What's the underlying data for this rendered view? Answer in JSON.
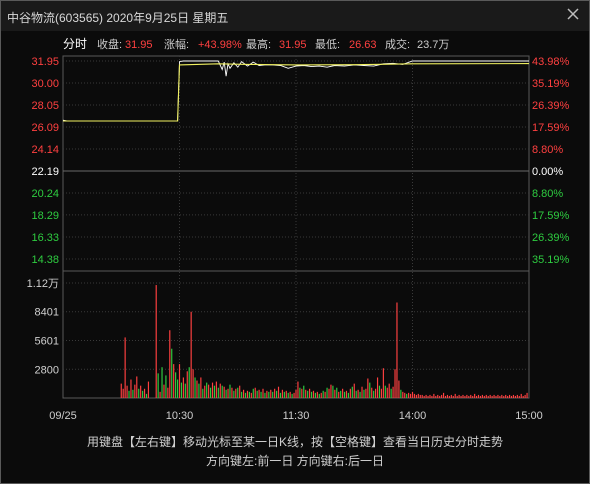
{
  "title": "中谷物流(603565) 2020年9月25日 星期五",
  "instructions": {
    "line1": "用键盘【左右键】移动光标至某一日K线，按【空格键】查看当日历史分时走势",
    "line2": "方向键左:前一日  方向键右:后一日"
  },
  "colors": {
    "up": "#ff4040",
    "down": "#2ecc40",
    "price_line": "#f0f060",
    "avg_line": "#ffffff",
    "grid": "#3a3a3a",
    "neutral": "#ffffff"
  },
  "info_bar": {
    "tab": "分时",
    "close_label": "收盘:",
    "close_value": "31.95",
    "change_label": "涨幅:",
    "change_value": "+43.98%",
    "high_label": "最高:",
    "high_value": "31.95",
    "low_label": "最低:",
    "low_value": "26.63",
    "volume_label": "成交:",
    "volume_value": "23.7万"
  },
  "chart_data": {
    "type": "line",
    "prev_close": 22.19,
    "price_axis": {
      "ylim": [
        14.38,
        31.95
      ],
      "ticks": [
        "31.95",
        "30.00",
        "28.05",
        "26.09",
        "24.14",
        "22.19",
        "20.24",
        "18.29",
        "16.33",
        "14.38"
      ],
      "values": [
        31.95,
        30.0,
        28.05,
        26.09,
        24.14,
        22.19,
        20.24,
        18.29,
        16.33,
        14.38
      ]
    },
    "pct_axis": {
      "ticks": [
        "43.98%",
        "35.19%",
        "26.39%",
        "17.59%",
        "8.80%",
        "0.00%",
        "8.80%",
        "17.59%",
        "26.39%",
        "35.19%"
      ]
    },
    "x_ticks": [
      "09/25",
      "10:30",
      "11:30",
      "14:00",
      "15:00"
    ],
    "series": [
      {
        "kind": "price",
        "points": [
          [
            0,
            26.7
          ],
          [
            2,
            26.63
          ],
          [
            30,
            26.63
          ],
          [
            58,
            26.63
          ],
          [
            59,
            26.63
          ],
          [
            60,
            31.9
          ],
          [
            62,
            31.95
          ],
          [
            80,
            31.95
          ],
          [
            82,
            31.2
          ],
          [
            83,
            31.85
          ],
          [
            84,
            30.6
          ],
          [
            85,
            31.7
          ],
          [
            86,
            31.3
          ],
          [
            88,
            31.8
          ],
          [
            90,
            31.4
          ],
          [
            92,
            31.9
          ],
          [
            95,
            31.5
          ],
          [
            98,
            31.85
          ],
          [
            101,
            31.55
          ],
          [
            104,
            31.6
          ],
          [
            108,
            31.6
          ],
          [
            112,
            31.55
          ],
          [
            116,
            31.3
          ],
          [
            120,
            31.5
          ],
          [
            124,
            31.55
          ],
          [
            128,
            31.45
          ],
          [
            132,
            31.5
          ],
          [
            136,
            31.4
          ],
          [
            140,
            31.55
          ],
          [
            145,
            31.5
          ],
          [
            150,
            31.6
          ],
          [
            155,
            31.55
          ],
          [
            160,
            31.5
          ],
          [
            165,
            31.7
          ],
          [
            170,
            31.75
          ],
          [
            175,
            31.65
          ],
          [
            180,
            31.95
          ],
          [
            240,
            31.95
          ]
        ]
      },
      {
        "kind": "average",
        "points": [
          [
            0,
            26.63
          ],
          [
            59,
            26.63
          ],
          [
            60,
            31.6
          ],
          [
            80,
            31.7
          ],
          [
            95,
            31.65
          ],
          [
            120,
            31.6
          ],
          [
            150,
            31.62
          ],
          [
            180,
            31.7
          ],
          [
            240,
            31.72
          ]
        ]
      }
    ],
    "volume": {
      "ticks": [
        "1.12万",
        "8401",
        "5601",
        "2800"
      ],
      "tick_values": [
        11200,
        8401,
        5601,
        2800
      ],
      "ylim": [
        0,
        11200
      ],
      "bars": [
        [
          30,
          1400,
          "up"
        ],
        [
          31,
          900,
          "up"
        ],
        [
          32,
          5900,
          "up"
        ],
        [
          33,
          1200,
          "up"
        ],
        [
          34,
          700,
          "down"
        ],
        [
          35,
          1800,
          "up"
        ],
        [
          36,
          800,
          "down"
        ],
        [
          37,
          1300,
          "up"
        ],
        [
          38,
          2100,
          "up"
        ],
        [
          39,
          900,
          "down"
        ],
        [
          40,
          1200,
          "up"
        ],
        [
          41,
          700,
          "down"
        ],
        [
          42,
          900,
          "up"
        ],
        [
          43,
          400,
          "down"
        ],
        [
          44,
          1600,
          "up"
        ],
        [
          48,
          11000,
          "up"
        ],
        [
          49,
          2400,
          "down"
        ],
        [
          50,
          600,
          "up"
        ],
        [
          51,
          3000,
          "down"
        ],
        [
          52,
          1300,
          "up"
        ],
        [
          53,
          2200,
          "down"
        ],
        [
          54,
          1000,
          "up"
        ],
        [
          55,
          6600,
          "up"
        ],
        [
          56,
          4800,
          "down"
        ],
        [
          57,
          3300,
          "up"
        ],
        [
          58,
          2500,
          "down"
        ],
        [
          59,
          1800,
          "down"
        ],
        [
          60,
          3300,
          "up"
        ],
        [
          61,
          1500,
          "down"
        ],
        [
          62,
          2000,
          "up"
        ],
        [
          63,
          1400,
          "down"
        ],
        [
          64,
          2600,
          "up"
        ],
        [
          65,
          3000,
          "down"
        ],
        [
          66,
          8400,
          "up"
        ],
        [
          67,
          2800,
          "up"
        ],
        [
          68,
          2000,
          "down"
        ],
        [
          69,
          1700,
          "up"
        ],
        [
          70,
          1400,
          "down"
        ],
        [
          71,
          2000,
          "up"
        ],
        [
          72,
          900,
          "down"
        ],
        [
          73,
          1200,
          "up"
        ],
        [
          74,
          1500,
          "down"
        ],
        [
          75,
          1300,
          "up"
        ],
        [
          76,
          1000,
          "down"
        ],
        [
          77,
          1500,
          "up"
        ],
        [
          78,
          1200,
          "down"
        ],
        [
          79,
          1600,
          "up"
        ],
        [
          80,
          1000,
          "down"
        ],
        [
          81,
          1400,
          "up"
        ],
        [
          82,
          1200,
          "down"
        ],
        [
          83,
          1100,
          "up"
        ],
        [
          84,
          800,
          "down"
        ],
        [
          85,
          900,
          "up"
        ],
        [
          86,
          1300,
          "down"
        ],
        [
          87,
          1000,
          "up"
        ],
        [
          88,
          700,
          "down"
        ],
        [
          89,
          900,
          "up"
        ],
        [
          90,
          1000,
          "down"
        ],
        [
          91,
          1200,
          "up"
        ],
        [
          92,
          600,
          "down"
        ],
        [
          93,
          800,
          "up"
        ],
        [
          94,
          500,
          "down"
        ],
        [
          95,
          700,
          "up"
        ],
        [
          96,
          600,
          "down"
        ],
        [
          97,
          500,
          "up"
        ],
        [
          98,
          900,
          "down"
        ],
        [
          99,
          1000,
          "up"
        ],
        [
          100,
          700,
          "down"
        ],
        [
          101,
          800,
          "up"
        ],
        [
          102,
          600,
          "down"
        ],
        [
          103,
          900,
          "up"
        ],
        [
          104,
          500,
          "down"
        ],
        [
          105,
          700,
          "up"
        ],
        [
          106,
          600,
          "down"
        ],
        [
          107,
          800,
          "up"
        ],
        [
          108,
          600,
          "down"
        ],
        [
          109,
          900,
          "up"
        ],
        [
          110,
          700,
          "down"
        ],
        [
          111,
          1100,
          "up"
        ],
        [
          112,
          500,
          "down"
        ],
        [
          113,
          800,
          "up"
        ],
        [
          114,
          600,
          "down"
        ],
        [
          115,
          700,
          "up"
        ],
        [
          116,
          500,
          "down"
        ],
        [
          117,
          600,
          "up"
        ],
        [
          118,
          400,
          "down"
        ],
        [
          119,
          500,
          "up"
        ],
        [
          120,
          800,
          "up"
        ],
        [
          121,
          1600,
          "up"
        ],
        [
          122,
          1000,
          "down"
        ],
        [
          123,
          900,
          "up"
        ],
        [
          124,
          1200,
          "down"
        ],
        [
          125,
          800,
          "up"
        ],
        [
          126,
          700,
          "down"
        ],
        [
          127,
          900,
          "up"
        ],
        [
          128,
          600,
          "down"
        ],
        [
          129,
          700,
          "up"
        ],
        [
          130,
          500,
          "down"
        ],
        [
          131,
          600,
          "up"
        ],
        [
          132,
          400,
          "down"
        ],
        [
          133,
          500,
          "up"
        ],
        [
          134,
          700,
          "down"
        ],
        [
          135,
          600,
          "up"
        ],
        [
          136,
          1000,
          "down"
        ],
        [
          137,
          900,
          "up"
        ],
        [
          138,
          1300,
          "up"
        ],
        [
          139,
          1200,
          "down"
        ],
        [
          140,
          800,
          "up"
        ],
        [
          141,
          1000,
          "down"
        ],
        [
          142,
          600,
          "up"
        ],
        [
          143,
          700,
          "down"
        ],
        [
          144,
          900,
          "up"
        ],
        [
          145,
          600,
          "down"
        ],
        [
          146,
          700,
          "up"
        ],
        [
          147,
          500,
          "down"
        ],
        [
          148,
          900,
          "up"
        ],
        [
          149,
          1100,
          "down"
        ],
        [
          150,
          1400,
          "up"
        ],
        [
          151,
          700,
          "down"
        ],
        [
          152,
          800,
          "up"
        ],
        [
          153,
          600,
          "down"
        ],
        [
          154,
          1100,
          "up"
        ],
        [
          155,
          800,
          "down"
        ],
        [
          156,
          900,
          "up"
        ],
        [
          157,
          1900,
          "up"
        ],
        [
          158,
          1500,
          "down"
        ],
        [
          159,
          1000,
          "up"
        ],
        [
          160,
          700,
          "down"
        ],
        [
          161,
          900,
          "up"
        ],
        [
          162,
          2000,
          "up"
        ],
        [
          163,
          1200,
          "down"
        ],
        [
          164,
          900,
          "up"
        ],
        [
          165,
          2900,
          "up"
        ],
        [
          166,
          1200,
          "down"
        ],
        [
          167,
          1000,
          "up"
        ],
        [
          168,
          1400,
          "up"
        ],
        [
          169,
          900,
          "down"
        ],
        [
          170,
          1100,
          "up"
        ],
        [
          171,
          2800,
          "up"
        ],
        [
          172,
          9300,
          "up"
        ],
        [
          173,
          1700,
          "up"
        ],
        [
          174,
          800,
          "down"
        ],
        [
          175,
          600,
          "up"
        ],
        [
          176,
          500,
          "up"
        ],
        [
          177,
          400,
          "down"
        ],
        [
          178,
          500,
          "up"
        ],
        [
          179,
          400,
          "up"
        ],
        [
          180,
          600,
          "up"
        ],
        [
          181,
          400,
          "up"
        ],
        [
          182,
          300,
          "up"
        ],
        [
          183,
          400,
          "up"
        ],
        [
          184,
          300,
          "up"
        ],
        [
          185,
          300,
          "up"
        ],
        [
          186,
          200,
          "up"
        ],
        [
          187,
          300,
          "up"
        ],
        [
          188,
          200,
          "up"
        ],
        [
          189,
          300,
          "up"
        ],
        [
          190,
          200,
          "up"
        ],
        [
          191,
          400,
          "up"
        ],
        [
          192,
          200,
          "up"
        ],
        [
          193,
          300,
          "up"
        ],
        [
          194,
          200,
          "up"
        ],
        [
          195,
          300,
          "up"
        ],
        [
          196,
          500,
          "up"
        ],
        [
          197,
          200,
          "up"
        ],
        [
          198,
          300,
          "up"
        ],
        [
          199,
          200,
          "up"
        ],
        [
          200,
          300,
          "up"
        ],
        [
          201,
          200,
          "up"
        ],
        [
          202,
          400,
          "up"
        ],
        [
          203,
          200,
          "up"
        ],
        [
          204,
          300,
          "up"
        ],
        [
          205,
          200,
          "up"
        ],
        [
          206,
          300,
          "up"
        ],
        [
          207,
          200,
          "up"
        ],
        [
          208,
          300,
          "up"
        ],
        [
          209,
          200,
          "up"
        ],
        [
          210,
          300,
          "up"
        ],
        [
          211,
          200,
          "up"
        ],
        [
          212,
          400,
          "up"
        ],
        [
          213,
          200,
          "up"
        ],
        [
          214,
          300,
          "up"
        ],
        [
          215,
          200,
          "up"
        ],
        [
          216,
          300,
          "up"
        ],
        [
          217,
          200,
          "up"
        ],
        [
          218,
          300,
          "up"
        ],
        [
          219,
          200,
          "up"
        ],
        [
          220,
          300,
          "up"
        ],
        [
          221,
          200,
          "up"
        ],
        [
          222,
          300,
          "up"
        ],
        [
          223,
          200,
          "up"
        ],
        [
          224,
          300,
          "up"
        ],
        [
          225,
          200,
          "up"
        ],
        [
          226,
          300,
          "up"
        ],
        [
          227,
          200,
          "up"
        ],
        [
          228,
          300,
          "up"
        ],
        [
          229,
          200,
          "up"
        ],
        [
          230,
          300,
          "up"
        ],
        [
          231,
          200,
          "up"
        ],
        [
          232,
          300,
          "up"
        ],
        [
          233,
          200,
          "up"
        ],
        [
          234,
          300,
          "up"
        ],
        [
          235,
          200,
          "up"
        ],
        [
          236,
          400,
          "up"
        ],
        [
          237,
          200,
          "up"
        ],
        [
          238,
          300,
          "up"
        ],
        [
          239,
          500,
          "up"
        ]
      ]
    }
  }
}
